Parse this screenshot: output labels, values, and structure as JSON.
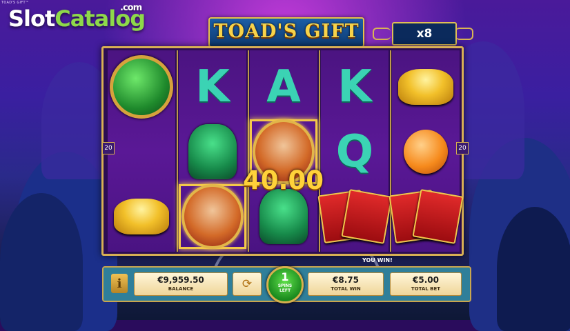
{
  "game_title_small": "TOAD'S GIFT™",
  "watermark": {
    "part1": "Slot",
    "part2": "Catalog",
    "suffix": ".com"
  },
  "logo_text": "TOAD'S GIFT",
  "multiplier": "x8",
  "paylines_left": "20",
  "paylines_right": "20",
  "reels": [
    [
      "jade-dragon-coin-icon",
      "blank",
      "gold-ingot-icon"
    ],
    [
      "letter-k-icon",
      "jade-lion-icon",
      "fortune-god-icon"
    ],
    [
      "letter-a-icon",
      "fortune-god-icon",
      "jade-lion-icon"
    ],
    [
      "letter-k-icon",
      "letter-q-icon",
      "red-envelope-icon"
    ],
    [
      "gold-ingot-icon",
      "orange-icon",
      "red-envelope-icon"
    ]
  ],
  "symbol_letters": {
    "k": "K",
    "a": "A",
    "q": "Q"
  },
  "win_amount": "40.00",
  "you_win": "YOU WIN!",
  "bottom_bar": {
    "info_label": "i",
    "balance_value": "€9,959.50",
    "balance_label": "BALANCE",
    "refresh_icon": "⟳",
    "spins_count": "1",
    "spins_label_line1": "SPINS",
    "spins_label_line2": "LEFT",
    "total_win_value": "€8.75",
    "total_win_label": "TOTAL WIN",
    "total_bet_value": "€5.00",
    "total_bet_label": "TOTAL BET"
  },
  "colors": {
    "frame_gold": "#d9b054",
    "bar_teal": "#2f7f9a",
    "win_yellow": "#ffd23a",
    "spin_green": "#1a8a1e"
  }
}
